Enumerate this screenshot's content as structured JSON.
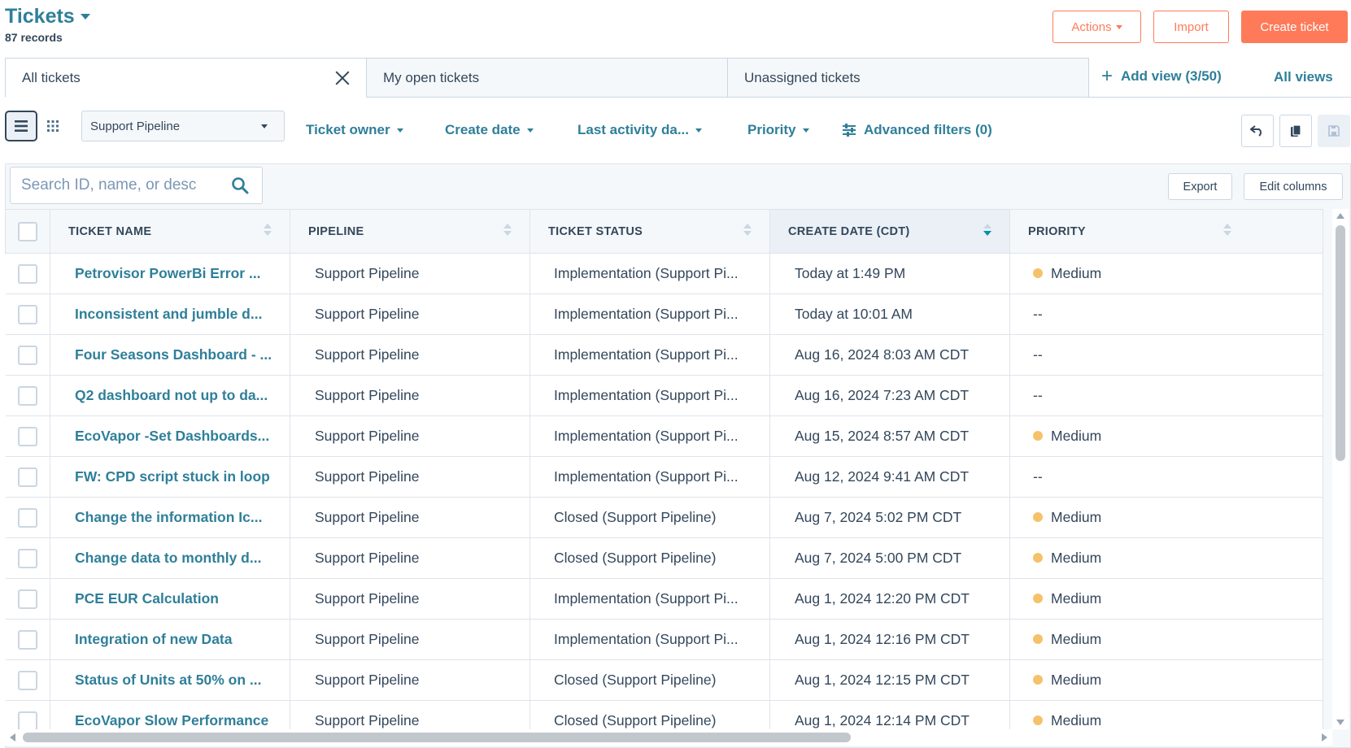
{
  "header": {
    "title": "Tickets",
    "records": "87 records",
    "actions_label": "Actions",
    "import_label": "Import",
    "create_label": "Create ticket"
  },
  "views": {
    "tabs": [
      {
        "label": "All tickets"
      },
      {
        "label": "My open tickets"
      },
      {
        "label": "Unassigned tickets"
      }
    ],
    "add_view_label": "Add view (3/50)",
    "all_views_label": "All views"
  },
  "filters": {
    "pipeline": "Support Pipeline",
    "ticket_owner": "Ticket owner",
    "create_date": "Create date",
    "last_activity": "Last activity da...",
    "priority": "Priority",
    "advanced": "Advanced filters (0)"
  },
  "toolbar": {
    "search_placeholder": "Search ID, name, or desc",
    "export_label": "Export",
    "edit_columns_label": "Edit columns"
  },
  "table": {
    "columns": [
      "TICKET NAME",
      "PIPELINE",
      "TICKET STATUS",
      "CREATE DATE (CDT)",
      "PRIORITY"
    ],
    "sorted_column": "CREATE DATE (CDT)",
    "rows": [
      {
        "name": "Petrovisor PowerBi Error ...",
        "pipeline": "Support Pipeline",
        "status": "Implementation (Support Pi...",
        "date": "Today at 1:49 PM",
        "priority": "Medium"
      },
      {
        "name": "Inconsistent and jumble d...",
        "pipeline": "Support Pipeline",
        "status": "Implementation (Support Pi...",
        "date": "Today at 10:01 AM",
        "priority": "--"
      },
      {
        "name": "Four Seasons Dashboard - ...",
        "pipeline": "Support Pipeline",
        "status": "Implementation (Support Pi...",
        "date": "Aug 16, 2024 8:03 AM CDT",
        "priority": "--"
      },
      {
        "name": "Q2 dashboard not up to da...",
        "pipeline": "Support Pipeline",
        "status": "Implementation (Support Pi...",
        "date": "Aug 16, 2024 7:23 AM CDT",
        "priority": "--"
      },
      {
        "name": "EcoVapor -Set Dashboards...",
        "pipeline": "Support Pipeline",
        "status": "Implementation (Support Pi...",
        "date": "Aug 15, 2024 8:57 AM CDT",
        "priority": "Medium"
      },
      {
        "name": "FW: CPD script stuck in loop",
        "pipeline": "Support Pipeline",
        "status": "Implementation (Support Pi...",
        "date": "Aug 12, 2024 9:41 AM CDT",
        "priority": "--"
      },
      {
        "name": "Change the information Ic...",
        "pipeline": "Support Pipeline",
        "status": "Closed (Support Pipeline)",
        "date": "Aug 7, 2024 5:02 PM CDT",
        "priority": "Medium"
      },
      {
        "name": "Change data to monthly d...",
        "pipeline": "Support Pipeline",
        "status": "Closed (Support Pipeline)",
        "date": "Aug 7, 2024 5:00 PM CDT",
        "priority": "Medium"
      },
      {
        "name": "PCE EUR Calculation",
        "pipeline": "Support Pipeline",
        "status": "Implementation (Support Pi...",
        "date": "Aug 1, 2024 12:20 PM CDT",
        "priority": "Medium"
      },
      {
        "name": "Integration of new Data",
        "pipeline": "Support Pipeline",
        "status": "Implementation (Support Pi...",
        "date": "Aug 1, 2024 12:16 PM CDT",
        "priority": "Medium"
      },
      {
        "name": "Status of Units at 50% on ...",
        "pipeline": "Support Pipeline",
        "status": "Closed (Support Pipeline)",
        "date": "Aug 1, 2024 12:15 PM CDT",
        "priority": "Medium"
      },
      {
        "name": "EcoVapor Slow Performance",
        "pipeline": "Support Pipeline",
        "status": "Closed (Support Pipeline)",
        "date": "Aug 1, 2024 12:14 PM CDT",
        "priority": "Medium"
      }
    ]
  },
  "colors": {
    "accent": "#ff7a59",
    "link": "#2f7f99",
    "medium_priority": "#f5c26b"
  }
}
